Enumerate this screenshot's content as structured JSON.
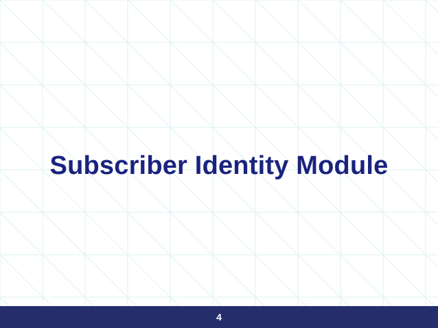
{
  "slide": {
    "title": "Subscriber Identity Module",
    "page_number": "4"
  },
  "colors": {
    "title": "#1a237e",
    "footer_bar": "#252e6b",
    "grid_lines": "#dff1f3",
    "background": "#ffffff"
  }
}
